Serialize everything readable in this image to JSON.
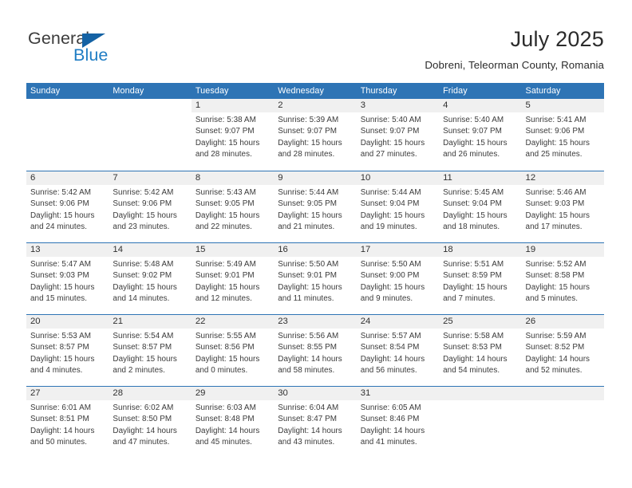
{
  "logo": {
    "part1": "General",
    "part2": "Blue",
    "triangle_color": "#1462A4",
    "blue_color": "#1F7DC4"
  },
  "header": {
    "title": "July 2025",
    "subtitle": "Dobreni, Teleorman County, Romania"
  },
  "theme": {
    "header_blue": "#2E74B5",
    "daynum_bg": "#F0F0F0",
    "text": "#3a3a3a"
  },
  "weekdays": [
    "Sunday",
    "Monday",
    "Tuesday",
    "Wednesday",
    "Thursday",
    "Friday",
    "Saturday"
  ],
  "weeks": [
    [
      {
        "day": "",
        "blank": true,
        "sunrise": "",
        "sunset": "",
        "daylight1": "",
        "daylight2": ""
      },
      {
        "day": "",
        "blank": true,
        "sunrise": "",
        "sunset": "",
        "daylight1": "",
        "daylight2": ""
      },
      {
        "day": "1",
        "sunrise": "Sunrise: 5:38 AM",
        "sunset": "Sunset: 9:07 PM",
        "daylight1": "Daylight: 15 hours",
        "daylight2": "and 28 minutes."
      },
      {
        "day": "2",
        "sunrise": "Sunrise: 5:39 AM",
        "sunset": "Sunset: 9:07 PM",
        "daylight1": "Daylight: 15 hours",
        "daylight2": "and 28 minutes."
      },
      {
        "day": "3",
        "sunrise": "Sunrise: 5:40 AM",
        "sunset": "Sunset: 9:07 PM",
        "daylight1": "Daylight: 15 hours",
        "daylight2": "and 27 minutes."
      },
      {
        "day": "4",
        "sunrise": "Sunrise: 5:40 AM",
        "sunset": "Sunset: 9:07 PM",
        "daylight1": "Daylight: 15 hours",
        "daylight2": "and 26 minutes."
      },
      {
        "day": "5",
        "sunrise": "Sunrise: 5:41 AM",
        "sunset": "Sunset: 9:06 PM",
        "daylight1": "Daylight: 15 hours",
        "daylight2": "and 25 minutes."
      }
    ],
    [
      {
        "day": "6",
        "sunrise": "Sunrise: 5:42 AM",
        "sunset": "Sunset: 9:06 PM",
        "daylight1": "Daylight: 15 hours",
        "daylight2": "and 24 minutes."
      },
      {
        "day": "7",
        "sunrise": "Sunrise: 5:42 AM",
        "sunset": "Sunset: 9:06 PM",
        "daylight1": "Daylight: 15 hours",
        "daylight2": "and 23 minutes."
      },
      {
        "day": "8",
        "sunrise": "Sunrise: 5:43 AM",
        "sunset": "Sunset: 9:05 PM",
        "daylight1": "Daylight: 15 hours",
        "daylight2": "and 22 minutes."
      },
      {
        "day": "9",
        "sunrise": "Sunrise: 5:44 AM",
        "sunset": "Sunset: 9:05 PM",
        "daylight1": "Daylight: 15 hours",
        "daylight2": "and 21 minutes."
      },
      {
        "day": "10",
        "sunrise": "Sunrise: 5:44 AM",
        "sunset": "Sunset: 9:04 PM",
        "daylight1": "Daylight: 15 hours",
        "daylight2": "and 19 minutes."
      },
      {
        "day": "11",
        "sunrise": "Sunrise: 5:45 AM",
        "sunset": "Sunset: 9:04 PM",
        "daylight1": "Daylight: 15 hours",
        "daylight2": "and 18 minutes."
      },
      {
        "day": "12",
        "sunrise": "Sunrise: 5:46 AM",
        "sunset": "Sunset: 9:03 PM",
        "daylight1": "Daylight: 15 hours",
        "daylight2": "and 17 minutes."
      }
    ],
    [
      {
        "day": "13",
        "sunrise": "Sunrise: 5:47 AM",
        "sunset": "Sunset: 9:03 PM",
        "daylight1": "Daylight: 15 hours",
        "daylight2": "and 15 minutes."
      },
      {
        "day": "14",
        "sunrise": "Sunrise: 5:48 AM",
        "sunset": "Sunset: 9:02 PM",
        "daylight1": "Daylight: 15 hours",
        "daylight2": "and 14 minutes."
      },
      {
        "day": "15",
        "sunrise": "Sunrise: 5:49 AM",
        "sunset": "Sunset: 9:01 PM",
        "daylight1": "Daylight: 15 hours",
        "daylight2": "and 12 minutes."
      },
      {
        "day": "16",
        "sunrise": "Sunrise: 5:50 AM",
        "sunset": "Sunset: 9:01 PM",
        "daylight1": "Daylight: 15 hours",
        "daylight2": "and 11 minutes."
      },
      {
        "day": "17",
        "sunrise": "Sunrise: 5:50 AM",
        "sunset": "Sunset: 9:00 PM",
        "daylight1": "Daylight: 15 hours",
        "daylight2": "and 9 minutes."
      },
      {
        "day": "18",
        "sunrise": "Sunrise: 5:51 AM",
        "sunset": "Sunset: 8:59 PM",
        "daylight1": "Daylight: 15 hours",
        "daylight2": "and 7 minutes."
      },
      {
        "day": "19",
        "sunrise": "Sunrise: 5:52 AM",
        "sunset": "Sunset: 8:58 PM",
        "daylight1": "Daylight: 15 hours",
        "daylight2": "and 5 minutes."
      }
    ],
    [
      {
        "day": "20",
        "sunrise": "Sunrise: 5:53 AM",
        "sunset": "Sunset: 8:57 PM",
        "daylight1": "Daylight: 15 hours",
        "daylight2": "and 4 minutes."
      },
      {
        "day": "21",
        "sunrise": "Sunrise: 5:54 AM",
        "sunset": "Sunset: 8:57 PM",
        "daylight1": "Daylight: 15 hours",
        "daylight2": "and 2 minutes."
      },
      {
        "day": "22",
        "sunrise": "Sunrise: 5:55 AM",
        "sunset": "Sunset: 8:56 PM",
        "daylight1": "Daylight: 15 hours",
        "daylight2": "and 0 minutes."
      },
      {
        "day": "23",
        "sunrise": "Sunrise: 5:56 AM",
        "sunset": "Sunset: 8:55 PM",
        "daylight1": "Daylight: 14 hours",
        "daylight2": "and 58 minutes."
      },
      {
        "day": "24",
        "sunrise": "Sunrise: 5:57 AM",
        "sunset": "Sunset: 8:54 PM",
        "daylight1": "Daylight: 14 hours",
        "daylight2": "and 56 minutes."
      },
      {
        "day": "25",
        "sunrise": "Sunrise: 5:58 AM",
        "sunset": "Sunset: 8:53 PM",
        "daylight1": "Daylight: 14 hours",
        "daylight2": "and 54 minutes."
      },
      {
        "day": "26",
        "sunrise": "Sunrise: 5:59 AM",
        "sunset": "Sunset: 8:52 PM",
        "daylight1": "Daylight: 14 hours",
        "daylight2": "and 52 minutes."
      }
    ],
    [
      {
        "day": "27",
        "sunrise": "Sunrise: 6:01 AM",
        "sunset": "Sunset: 8:51 PM",
        "daylight1": "Daylight: 14 hours",
        "daylight2": "and 50 minutes."
      },
      {
        "day": "28",
        "sunrise": "Sunrise: 6:02 AM",
        "sunset": "Sunset: 8:50 PM",
        "daylight1": "Daylight: 14 hours",
        "daylight2": "and 47 minutes."
      },
      {
        "day": "29",
        "sunrise": "Sunrise: 6:03 AM",
        "sunset": "Sunset: 8:48 PM",
        "daylight1": "Daylight: 14 hours",
        "daylight2": "and 45 minutes."
      },
      {
        "day": "30",
        "sunrise": "Sunrise: 6:04 AM",
        "sunset": "Sunset: 8:47 PM",
        "daylight1": "Daylight: 14 hours",
        "daylight2": "and 43 minutes."
      },
      {
        "day": "31",
        "sunrise": "Sunrise: 6:05 AM",
        "sunset": "Sunset: 8:46 PM",
        "daylight1": "Daylight: 14 hours",
        "daylight2": "and 41 minutes."
      },
      {
        "day": "",
        "empty": true,
        "sunrise": "",
        "sunset": "",
        "daylight1": "",
        "daylight2": ""
      },
      {
        "day": "",
        "empty": true,
        "sunrise": "",
        "sunset": "",
        "daylight1": "",
        "daylight2": ""
      }
    ]
  ]
}
